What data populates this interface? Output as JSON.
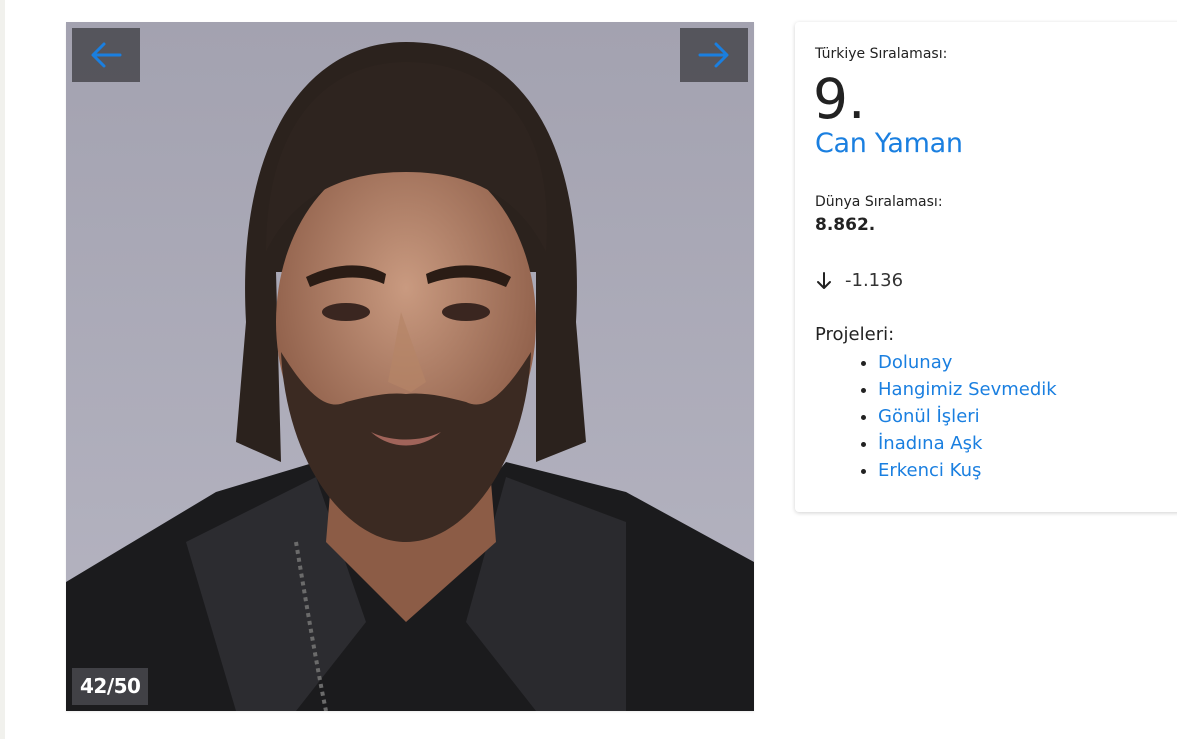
{
  "gallery": {
    "counter": "42/50",
    "prev_icon": "arrow-left-icon",
    "next_icon": "arrow-right-icon"
  },
  "profile": {
    "turkey_rank_label": "Türkiye Sıralaması:",
    "turkey_rank": "9.",
    "name": "Can Yaman",
    "world_rank_label": "Dünya Sıralaması:",
    "world_rank": "8.862.",
    "change_icon": "arrow-down-icon",
    "change": "-1.136",
    "projects_label": "Projeleri:",
    "projects": [
      "Dolunay",
      "Hangimiz Sevmedik",
      "Gönül İşleri",
      "İnadına Aşk",
      "Erkenci Kuş"
    ]
  },
  "colors": {
    "link": "#1a7fe0",
    "arrow": "#1a7fe0",
    "nav_bg": "#48484e",
    "text": "#222222"
  }
}
